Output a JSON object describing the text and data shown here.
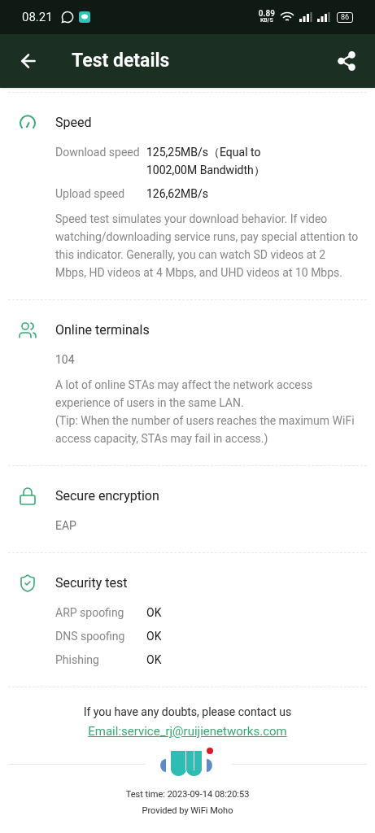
{
  "status_bar": {
    "time": "08.21",
    "net_speed": "0.89",
    "net_unit": "KB/S",
    "battery": "86"
  },
  "app_bar": {
    "title": "Test details"
  },
  "sections": [
    {
      "kind": "speed",
      "title": "Speed",
      "rows": [
        {
          "label": "Download speed",
          "value": "125,25MB/s（Equal to 1002,00M Bandwidth）"
        },
        {
          "label": "Upload speed",
          "value": "126,62MB/s"
        }
      ],
      "notes": [
        "Speed test simulates your download behavior. If video watching/downloading service runs, pay special attention to this indicator. Generally, you can watch SD videos at 2 Mbps, HD videos at 4 Mbps, and UHD videos at 10 Mbps."
      ]
    },
    {
      "kind": "users",
      "title": "Online terminals",
      "value": "104",
      "notes": [
        "A lot of online STAs may affect the network access experience of users in the same LAN.",
        "(Tip: When the number of users reaches the maximum WiFi access capacity, STAs may fail in access.)"
      ]
    },
    {
      "kind": "lock",
      "title": "Secure encryption",
      "value": "EAP"
    },
    {
      "kind": "shield",
      "title": "Security test",
      "rows": [
        {
          "label": "ARP spoofing",
          "value": "OK"
        },
        {
          "label": "DNS spoofing",
          "value": "OK"
        },
        {
          "label": "Phishing",
          "value": "OK"
        }
      ]
    }
  ],
  "footer": {
    "contact": "If you have any doubts, please contact us",
    "email": "Email:service_rj@ruijienetworks.com",
    "test_time": "Test time: 2023-09-14 08:20:53",
    "provider": "Provided by WiFi Moho"
  }
}
